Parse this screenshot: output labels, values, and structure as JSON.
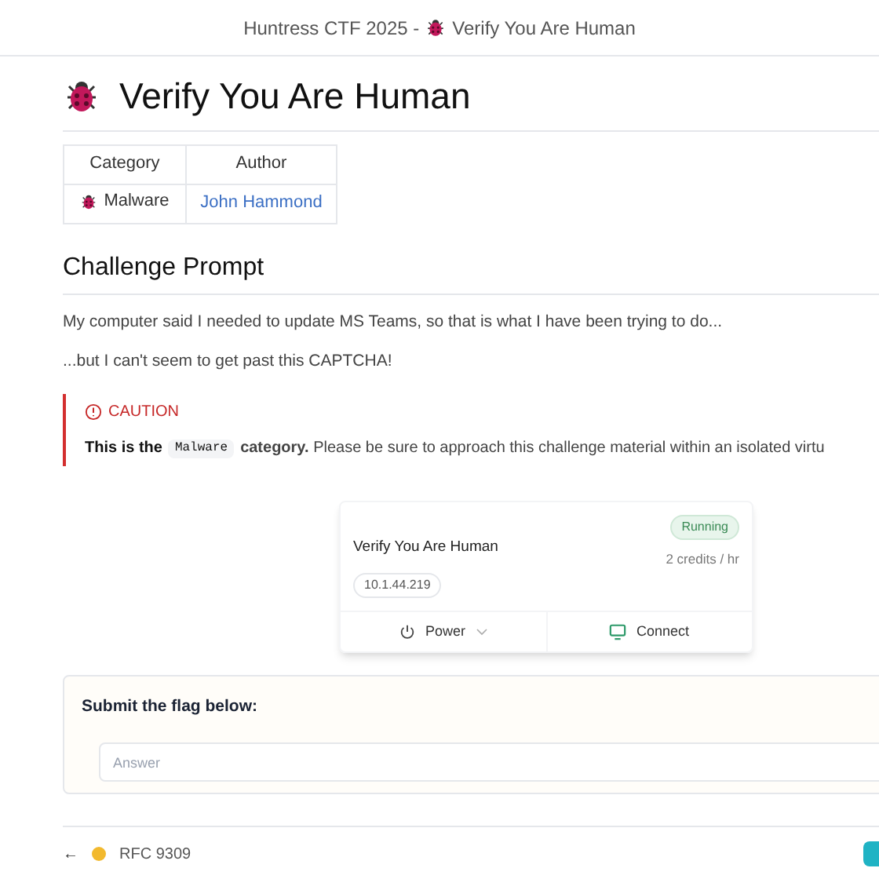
{
  "window": {
    "title_prefix": "Huntress CTF 2025 -",
    "title": "Verify You Are Human"
  },
  "heading": "Verify You Are Human",
  "info_table": {
    "columns": [
      "Category",
      "Author"
    ],
    "category": "Malware",
    "author": "John Hammond"
  },
  "section_title": "Challenge Prompt",
  "paragraphs": [
    "My computer said I needed to update MS Teams, so that is what I have been trying to do...",
    "...but I can't seem to get past this CAPTCHA!"
  ],
  "caution": {
    "label": "CAUTION",
    "lead": "This is the",
    "code": "Malware",
    "text": "**category.** Please be sure to approach this challenge material within an isolated virtu"
  },
  "instance": {
    "name": "Verify You Are Human",
    "status": "Running",
    "running": true,
    "cost": "2 credits / hr",
    "ip": "10.1.44.219",
    "actions": [
      "Power",
      "Connect"
    ]
  },
  "submit": {
    "label": "Submit the flag below:",
    "placeholder": "Answer"
  },
  "footer": {
    "back": "←",
    "link": "RFC 9309"
  }
}
